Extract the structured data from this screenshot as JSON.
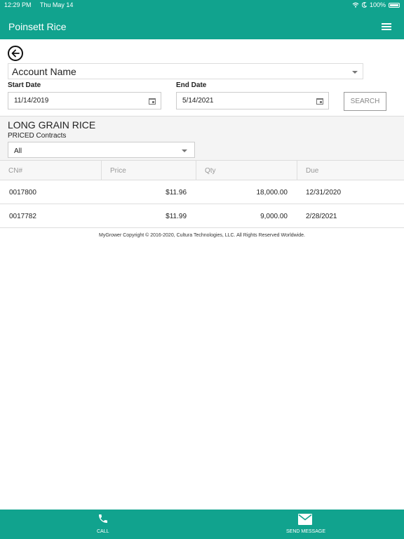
{
  "status": {
    "time": "12:29 PM",
    "date": "Thu May 14",
    "battery": "100%"
  },
  "header": {
    "title": "Poinsett Rice",
    "menu_icon": "hamburger-menu-icon"
  },
  "back_icon": "arrow-left-circle-icon",
  "account": {
    "selected": "Account Name"
  },
  "filters": {
    "start_label": "Start Date",
    "start_value": "11/14/2019",
    "end_label": "End Date",
    "end_value": "5/14/2021",
    "search_label": "SEARCH"
  },
  "commodity": {
    "title": "LONG GRAIN RICE",
    "contract_type": "PRICED Contracts",
    "filter_selected": "All"
  },
  "table": {
    "headers": [
      "CN#",
      "Price",
      "Qty",
      "Due"
    ],
    "rows": [
      {
        "cn": "0017800",
        "price": "$11.96",
        "qty": "18,000.00",
        "due": "12/31/2020"
      },
      {
        "cn": "0017782",
        "price": "$11.99",
        "qty": "9,000.00",
        "due": "2/28/2021"
      }
    ]
  },
  "footer": {
    "copyright": "MyGrower Copyright © 2016-2020, Cultura Technologies, LLC. All Rights Reserved Worldwide."
  },
  "bottom_nav": {
    "call_label": "CALL",
    "message_label": "SEND MESSAGE"
  },
  "colors": {
    "brand": "#11a38e"
  }
}
